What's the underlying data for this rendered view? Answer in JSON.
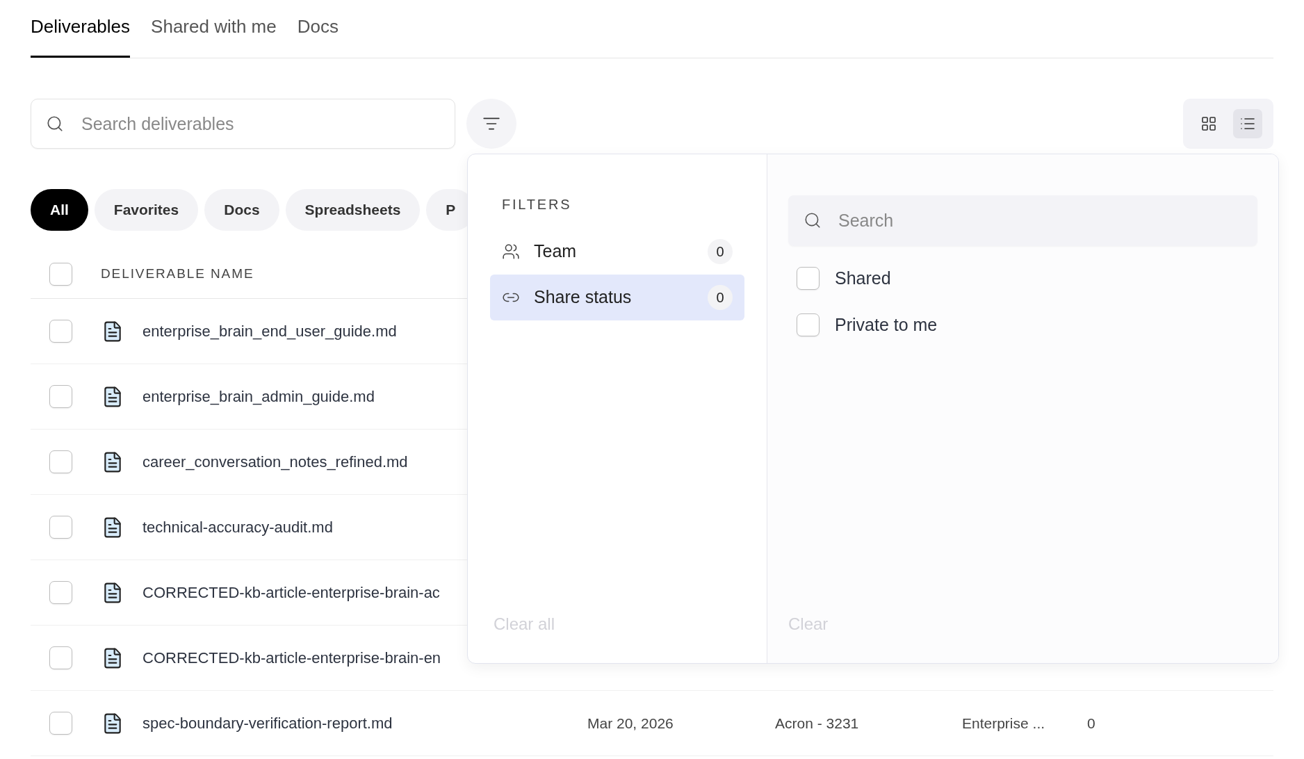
{
  "tabs": [
    {
      "label": "Deliverables",
      "selected": true
    },
    {
      "label": "Shared with me",
      "selected": false
    },
    {
      "label": "Docs",
      "selected": false
    }
  ],
  "search": {
    "placeholder": "Search deliverables"
  },
  "view_toggle": [
    {
      "kind": "grid",
      "selected": false
    },
    {
      "kind": "list",
      "selected": true
    }
  ],
  "chips": [
    {
      "label": "All",
      "selected": true
    },
    {
      "label": "Favorites",
      "selected": false
    },
    {
      "label": "Docs",
      "selected": false
    },
    {
      "label": "Spreadsheets",
      "selected": false
    },
    {
      "label": "P",
      "selected": false
    }
  ],
  "table": {
    "columns": [
      "DELIVERABLE NAME"
    ],
    "header_checked": false,
    "rows": [
      {
        "name": "enterprise_brain_end_user_guide.md",
        "checked": false
      },
      {
        "name": "enterprise_brain_admin_guide.md",
        "checked": false
      },
      {
        "name": "career_conversation_notes_refined.md",
        "checked": false
      },
      {
        "name": "technical-accuracy-audit.md",
        "checked": false
      },
      {
        "name": "CORRECTED-kb-article-enterprise-brain-ac",
        "checked": false
      },
      {
        "name": "CORRECTED-kb-article-enterprise-brain-en",
        "checked": false
      },
      {
        "name": "spec-boundary-verification-report.md",
        "checked": false,
        "column_2": "Mar 20, 2026",
        "column_3": "Acron - 3231",
        "column_4": "Enterprise ...",
        "column_5": "0"
      }
    ]
  },
  "filter_popover": {
    "title": "FILTERS",
    "categories": [
      {
        "kind": "team",
        "label": "Team",
        "count": "0",
        "selected": false
      },
      {
        "kind": "link",
        "label": "Share status",
        "count": "0",
        "selected": true
      }
    ],
    "clear_all": "Clear all",
    "search": {
      "placeholder": "Search"
    },
    "options": [
      {
        "label": "Shared",
        "checked": false
      },
      {
        "label": "Private to me",
        "checked": false
      }
    ],
    "clear": "Clear"
  }
}
